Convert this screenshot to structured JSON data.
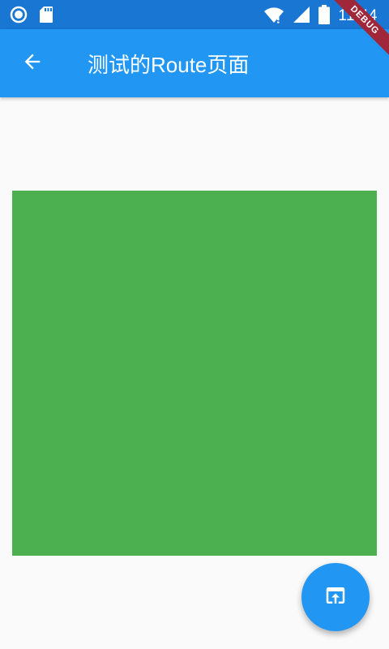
{
  "status_bar": {
    "time": "11:44",
    "icons": [
      "record-icon",
      "sd-card-icon",
      "wifi-icon",
      "signal-icon",
      "battery-icon"
    ]
  },
  "app_bar": {
    "back_icon": "arrow-back-icon",
    "title": "测试的Route页面"
  },
  "debug_banner": {
    "label": "DEBUG"
  },
  "content": {
    "box_color": "#4caf50"
  },
  "fab": {
    "icon": "open-in-browser-icon"
  },
  "colors": {
    "primary": "#2196f3",
    "primary_dark": "#1976d2",
    "accent_green": "#4caf50",
    "background": "#fafafa"
  }
}
